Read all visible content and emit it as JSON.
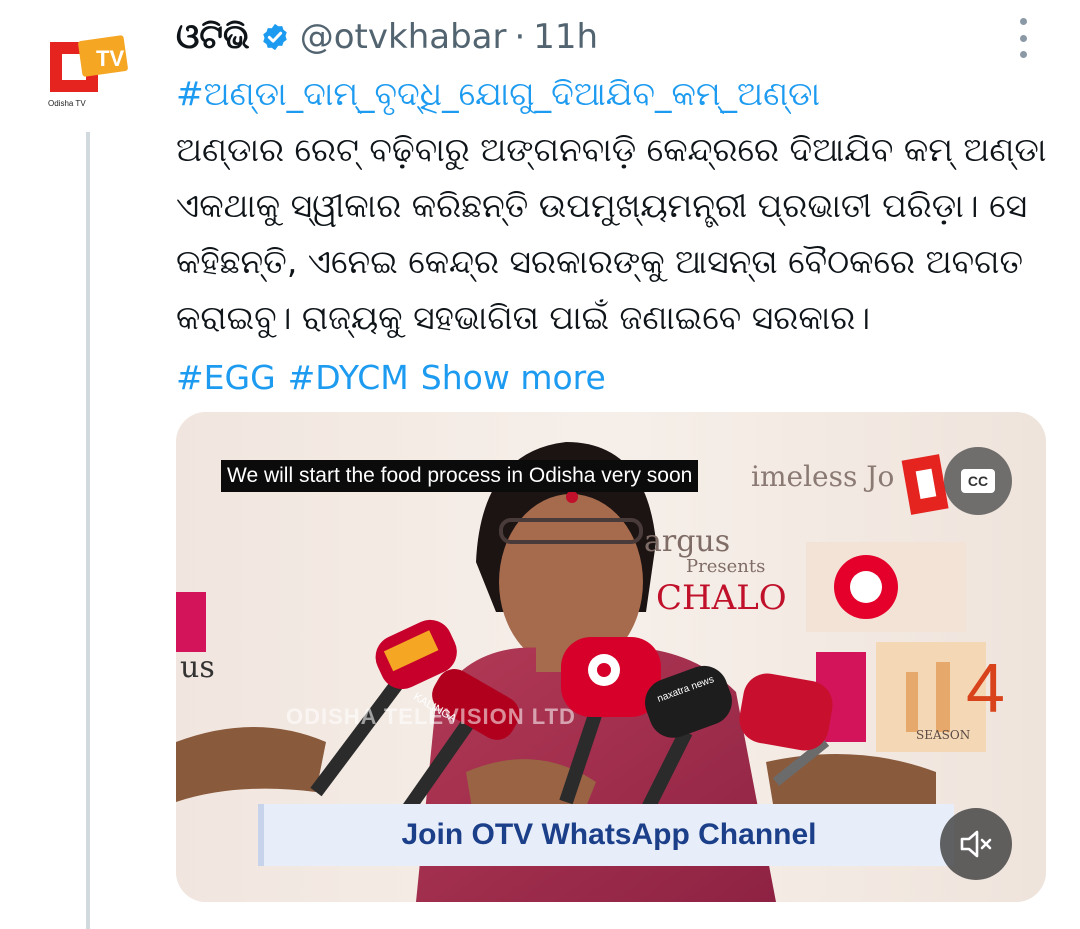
{
  "tweet": {
    "avatar_label": "Odisha TV",
    "display_name": "ଓଟିଭି",
    "handle": "@otvkhabar",
    "separator": "·",
    "time": "11h",
    "hashtag_top": "#ଅଣ୍ଡା_ଦାମ୍_ବୃଦ୍ଧି_ଯୋଗୁ_ଦିଆଯିବ_କମ୍_ଅଣ୍ଡା",
    "body_lines": [
      "ଅଣ୍ଡାର ରେଟ୍ ବଢ଼ିବାରୁ ଅଙ୍ଗନବାଡ଼ି କେନ୍ଦ୍ରରେ ଦିଆଯିବ କମ୍ ଅଣ୍ଡା।",
      "ଏକଥାକୁ ସ୍ୱୀକାର କରିଛନ୍ତି ଉପମୁଖ୍ୟମନ୍ତ୍ରୀ ପ୍ରଭାତୀ ପରିଡ଼ା। ସେ",
      "କହିଛନ୍ତି, ଏନେଇ କେନ୍ଦ୍ର ସରକାରଙ୍କୁ ଆସନ୍ତା ବୈଠକରେ ଅବଗତ",
      "କରାଇବୁ। ରାଜ୍ୟକୁ ସହଭାଗିତା ପାଇଁ ଜଣାଇବେ ସରକାର।"
    ],
    "hashtags": [
      "#EGG",
      "#DYCM"
    ],
    "show_more": "Show more",
    "colors": {
      "link": "#1d9bf0",
      "verified": "#1d9bf0",
      "muted_text": "#536471"
    }
  },
  "video": {
    "caption": "We will start the food process in Odisha very soon",
    "cc_label": "CC",
    "banner_text": "Join OTV WhatsApp Channel",
    "mute_icon": "speaker-muted-icon",
    "backdrop_text": {
      "timeless": "imeless Jo",
      "argus": "argus",
      "presents": "Presents",
      "chalo": "CHALO",
      "season": "SEASON",
      "us": "us",
      "four": "4"
    },
    "watermark": "ODISHA TELEVISION LTD",
    "mic_labels": [
      "KALINGA",
      "naxatra news"
    ]
  }
}
